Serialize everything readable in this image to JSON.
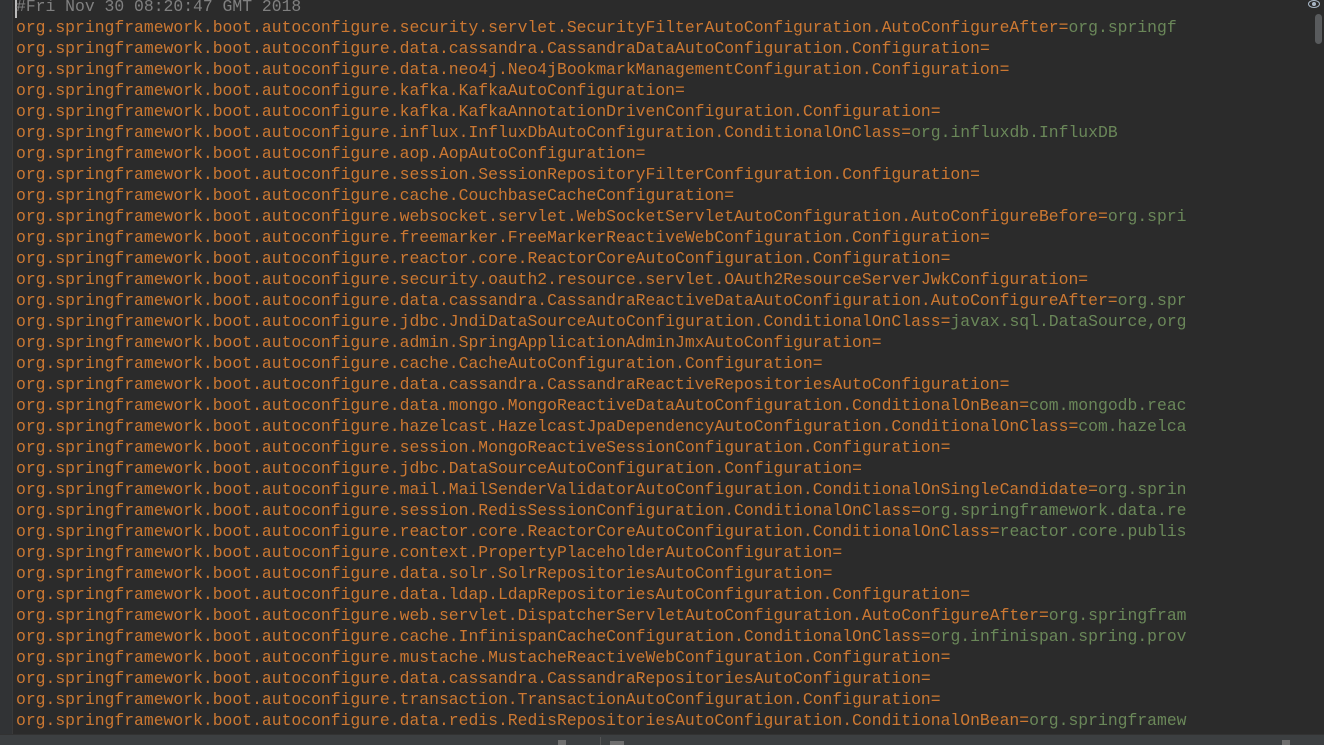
{
  "colors": {
    "background": "#2b2b2b",
    "comment": "#808080",
    "key": "#cc7832",
    "value": "#6a8759"
  },
  "editor": {
    "comment": "#Fri Nov 30 08:20:47 GMT 2018",
    "lines": [
      {
        "key": "org.springframework.boot.autoconfigure.security.servlet.SecurityFilterAutoConfiguration.AutoConfigureAfter",
        "value": "org.springf"
      },
      {
        "key": "org.springframework.boot.autoconfigure.data.cassandra.CassandraDataAutoConfiguration.Configuration",
        "value": ""
      },
      {
        "key": "org.springframework.boot.autoconfigure.data.neo4j.Neo4jBookmarkManagementConfiguration.Configuration",
        "value": ""
      },
      {
        "key": "org.springframework.boot.autoconfigure.kafka.KafkaAutoConfiguration",
        "value": ""
      },
      {
        "key": "org.springframework.boot.autoconfigure.kafka.KafkaAnnotationDrivenConfiguration.Configuration",
        "value": ""
      },
      {
        "key": "org.springframework.boot.autoconfigure.influx.InfluxDbAutoConfiguration.ConditionalOnClass",
        "value": "org.influxdb.InfluxDB"
      },
      {
        "key": "org.springframework.boot.autoconfigure.aop.AopAutoConfiguration",
        "value": ""
      },
      {
        "key": "org.springframework.boot.autoconfigure.session.SessionRepositoryFilterConfiguration.Configuration",
        "value": ""
      },
      {
        "key": "org.springframework.boot.autoconfigure.cache.CouchbaseCacheConfiguration",
        "value": ""
      },
      {
        "key": "org.springframework.boot.autoconfigure.websocket.servlet.WebSocketServletAutoConfiguration.AutoConfigureBefore",
        "value": "org.spri"
      },
      {
        "key": "org.springframework.boot.autoconfigure.freemarker.FreeMarkerReactiveWebConfiguration.Configuration",
        "value": ""
      },
      {
        "key": "org.springframework.boot.autoconfigure.reactor.core.ReactorCoreAutoConfiguration.Configuration",
        "value": ""
      },
      {
        "key": "org.springframework.boot.autoconfigure.security.oauth2.resource.servlet.OAuth2ResourceServerJwkConfiguration",
        "value": ""
      },
      {
        "key": "org.springframework.boot.autoconfigure.data.cassandra.CassandraReactiveDataAutoConfiguration.AutoConfigureAfter",
        "value": "org.spr"
      },
      {
        "key": "org.springframework.boot.autoconfigure.jdbc.JndiDataSourceAutoConfiguration.ConditionalOnClass",
        "value": "javax.sql.DataSource,org"
      },
      {
        "key": "org.springframework.boot.autoconfigure.admin.SpringApplicationAdminJmxAutoConfiguration",
        "value": ""
      },
      {
        "key": "org.springframework.boot.autoconfigure.cache.CacheAutoConfiguration.Configuration",
        "value": ""
      },
      {
        "key": "org.springframework.boot.autoconfigure.data.cassandra.CassandraReactiveRepositoriesAutoConfiguration",
        "value": ""
      },
      {
        "key": "org.springframework.boot.autoconfigure.data.mongo.MongoReactiveDataAutoConfiguration.ConditionalOnBean",
        "value": "com.mongodb.reac"
      },
      {
        "key": "org.springframework.boot.autoconfigure.hazelcast.HazelcastJpaDependencyAutoConfiguration.ConditionalOnClass",
        "value": "com.hazelca"
      },
      {
        "key": "org.springframework.boot.autoconfigure.session.MongoReactiveSessionConfiguration.Configuration",
        "value": ""
      },
      {
        "key": "org.springframework.boot.autoconfigure.jdbc.DataSourceAutoConfiguration.Configuration",
        "value": ""
      },
      {
        "key": "org.springframework.boot.autoconfigure.mail.MailSenderValidatorAutoConfiguration.ConditionalOnSingleCandidate",
        "value": "org.sprin"
      },
      {
        "key": "org.springframework.boot.autoconfigure.session.RedisSessionConfiguration.ConditionalOnClass",
        "value": "org.springframework.data.re"
      },
      {
        "key": "org.springframework.boot.autoconfigure.reactor.core.ReactorCoreAutoConfiguration.ConditionalOnClass",
        "value": "reactor.core.publis"
      },
      {
        "key": "org.springframework.boot.autoconfigure.context.PropertyPlaceholderAutoConfiguration",
        "value": ""
      },
      {
        "key": "org.springframework.boot.autoconfigure.data.solr.SolrRepositoriesAutoConfiguration",
        "value": ""
      },
      {
        "key": "org.springframework.boot.autoconfigure.data.ldap.LdapRepositoriesAutoConfiguration.Configuration",
        "value": ""
      },
      {
        "key": "org.springframework.boot.autoconfigure.web.servlet.DispatcherServletAutoConfiguration.AutoConfigureAfter",
        "value": "org.springfram"
      },
      {
        "key": "org.springframework.boot.autoconfigure.cache.InfinispanCacheConfiguration.ConditionalOnClass",
        "value": "org.infinispan.spring.prov"
      },
      {
        "key": "org.springframework.boot.autoconfigure.mustache.MustacheReactiveWebConfiguration.Configuration",
        "value": ""
      },
      {
        "key": "org.springframework.boot.autoconfigure.data.cassandra.CassandraRepositoriesAutoConfiguration",
        "value": ""
      },
      {
        "key": "org.springframework.boot.autoconfigure.transaction.TransactionAutoConfiguration.Configuration",
        "value": ""
      },
      {
        "key": "org.springframework.boot.autoconfigure.data.redis.RedisRepositoriesAutoConfiguration.ConditionalOnBean",
        "value": "org.springframew"
      }
    ]
  }
}
